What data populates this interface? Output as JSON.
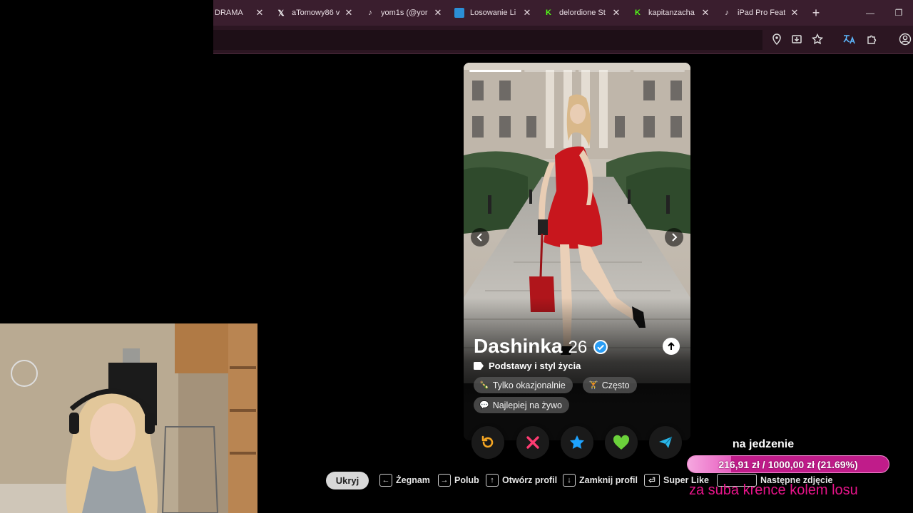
{
  "browser": {
    "tabs": [
      {
        "title": "DRAMA",
        "icon": "none-icon"
      },
      {
        "title": "aTomowy86 v",
        "icon": "x-logo-icon"
      },
      {
        "title": "yom1s (@yor",
        "icon": "tiktok-icon"
      },
      {
        "title": "Losowanie Li",
        "icon": "puzzle-blue-icon"
      },
      {
        "title": "delordione St",
        "icon": "kick-icon"
      },
      {
        "title": "kapitanzacha",
        "icon": "kick-icon"
      },
      {
        "title": "iPad Pro Feat",
        "icon": "tiktok-icon"
      }
    ],
    "new_tab_glyph": "+"
  },
  "profile": {
    "name": "Dashinka",
    "age": "26",
    "section_title": "Podstawy i styl życia",
    "chips": [
      "Tylko okazjonalnie",
      "Często",
      "Najlepiej na żywo"
    ],
    "photo_count": 4,
    "current_photo": 1
  },
  "actions": {
    "rewind": "rewind-icon",
    "nope": "nope-icon",
    "super_like": "star-icon",
    "like": "heart-icon",
    "boost": "send-icon"
  },
  "legend": {
    "hide": "Ukryj",
    "nope": "Żegnam",
    "like": "Polub",
    "open_profile": "Otwórz profil",
    "close_profile": "Zamknij profil",
    "super_like": "Super Like",
    "next_photo": "Następne zdjęcie"
  },
  "goal": {
    "title": "na jedzenie",
    "amount": "216,91 zł / 1000,00 zł (21.69%)",
    "fraction": 0.2169,
    "subtitle": "za suba krence kolem losu"
  },
  "colors": {
    "tabbar": "#3a1e2e",
    "toolbar": "#2c1622",
    "nope": "#fe3c72",
    "rewind": "#f5a623",
    "super_like": "#1ea3ff",
    "like": "#6bd13b",
    "boost": "#2ab6e8",
    "goal_bar": "#c01c8a",
    "goal_sub": "#e8148a"
  }
}
